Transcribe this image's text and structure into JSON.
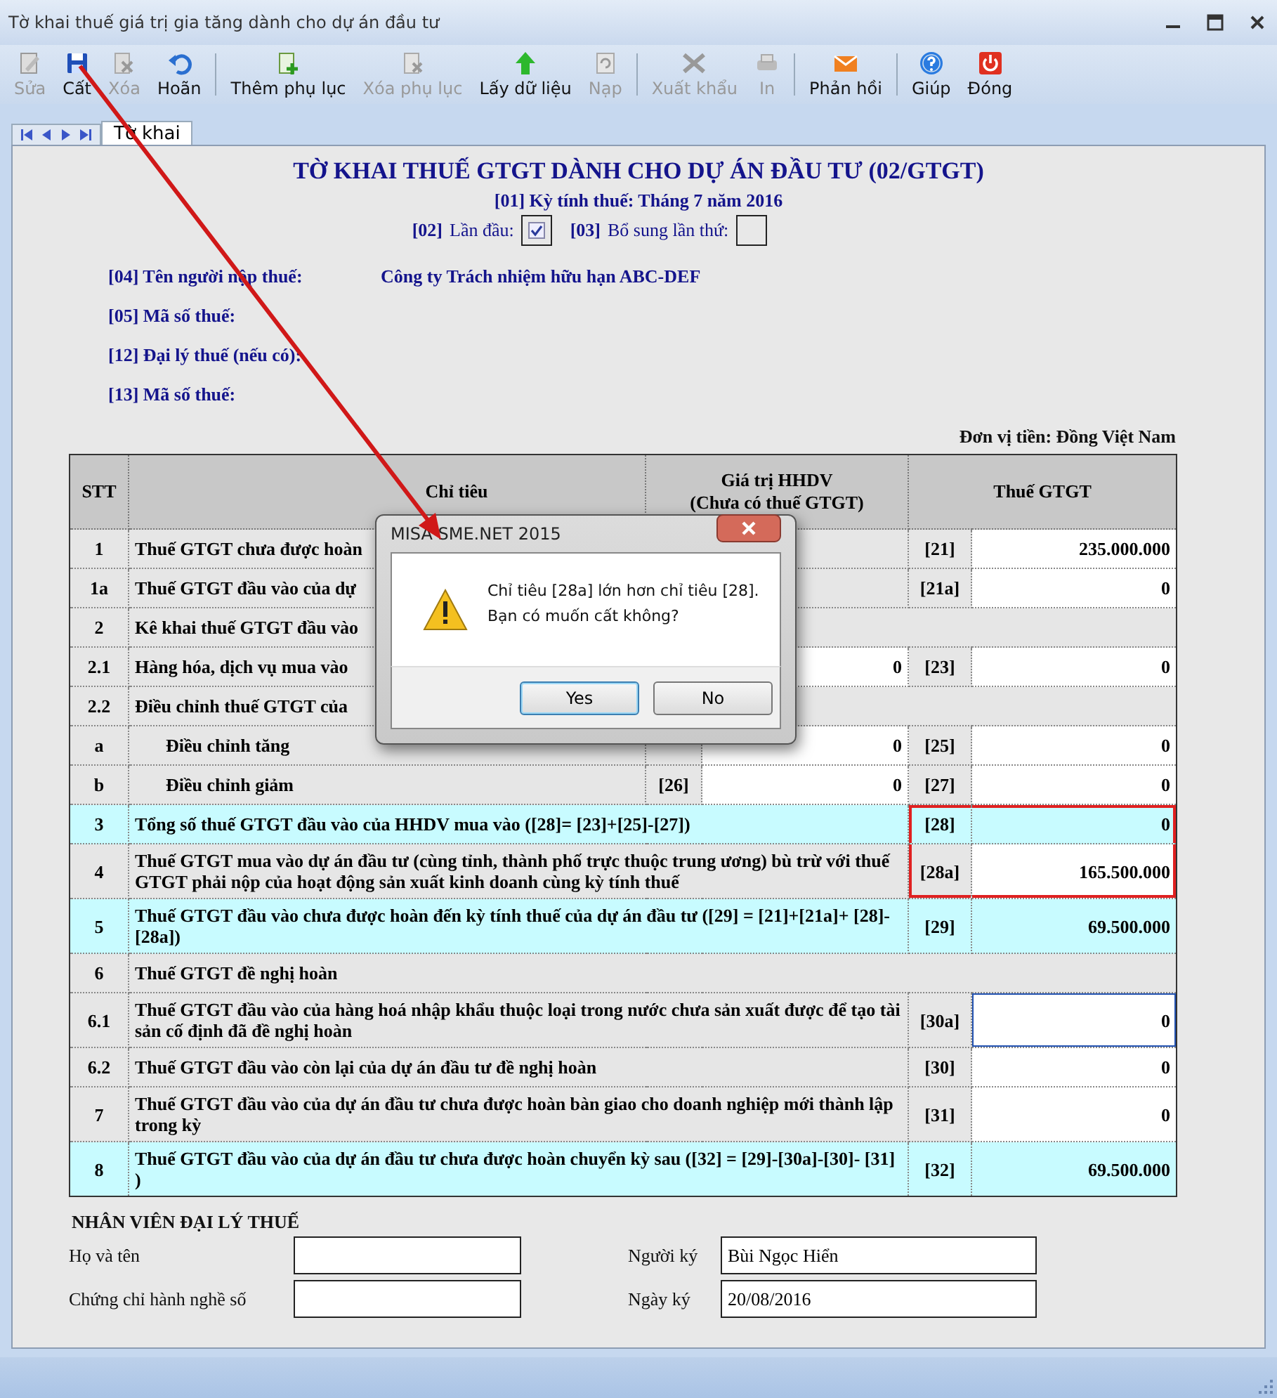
{
  "window": {
    "title": "Tờ khai thuế giá trị gia tăng dành cho dự án đầu tư"
  },
  "toolbar": [
    {
      "label": "Sửa",
      "disabled": true,
      "separator_after": false
    },
    {
      "label": "Cất",
      "disabled": false,
      "separator_after": false
    },
    {
      "label": "Xóa",
      "disabled": true,
      "separator_after": false
    },
    {
      "label": "Hoãn",
      "disabled": false,
      "separator_after": true
    },
    {
      "label": "Thêm phụ lục",
      "disabled": false,
      "separator_after": false
    },
    {
      "label": "Xóa phụ lục",
      "disabled": true,
      "separator_after": false
    },
    {
      "label": "Lấy dữ liệu",
      "disabled": false,
      "separator_after": false
    },
    {
      "label": "Nạp",
      "disabled": true,
      "separator_after": true
    },
    {
      "label": "Xuất khẩu",
      "disabled": true,
      "separator_after": false
    },
    {
      "label": "In",
      "disabled": true,
      "separator_after": true
    },
    {
      "label": "Phản hồi",
      "disabled": false,
      "separator_after": true
    },
    {
      "label": "Giúp",
      "disabled": false,
      "separator_after": false
    },
    {
      "label": "Đóng",
      "disabled": false,
      "separator_after": false
    }
  ],
  "tabs": [
    {
      "label": "Tờ khai",
      "selected": true
    }
  ],
  "form": {
    "title": "TỜ KHAI THUẾ GTGT DÀNH CHO DỰ ÁN ĐẦU TƯ (02/GTGT)",
    "period": "[01] Kỳ tính thuế: Tháng 7 năm 2016",
    "first_code": "[02]",
    "first_label": "Lần đầu:",
    "first_checked": true,
    "supplement_code": "[03]",
    "supplement_label": "Bổ sung lần thứ:",
    "info": [
      {
        "label": "[04] Tên người nộp thuế:",
        "value": "Công ty Trách nhiệm hữu hạn ABC-DEF"
      },
      {
        "label": "[05] Mã số thuế:"
      },
      {
        "label": "[12] Đại lý thuế (nếu có):"
      },
      {
        "label": "[13] Mã số thuế:"
      }
    ],
    "currency": "Đơn vị tiền: Đồng Việt Nam"
  },
  "table": {
    "columns": [
      "STT",
      "Chỉ tiêu",
      "Giá trị HHDV\n(Chưa có thuế GTGT)",
      "Thuế GTGT"
    ],
    "rows": [
      {
        "kind": "tax",
        "stt": "1",
        "label": "Thuế GTGT chưa được hoàn",
        "code": "[21]",
        "value": "235.000.000",
        "highlighted": false,
        "outlined": false,
        "focused": false
      },
      {
        "kind": "tax",
        "stt": "1a",
        "label": "Thuế GTGT đầu vào của dự",
        "code": "[21a]",
        "value": "0",
        "highlighted": false,
        "outlined": false,
        "focused": false
      },
      {
        "kind": "section",
        "stt": "2",
        "label": "Kê khai thuế GTGT đầu vào"
      },
      {
        "kind": "both",
        "stt": "2.1",
        "label": "Hàng hóa, dịch vụ mua vào",
        "gt_value": "0",
        "code": "[23]",
        "value": "0",
        "highlighted": false,
        "outlined": false,
        "focused": false
      },
      {
        "kind": "section",
        "stt": "2.2",
        "label": "Điều chỉnh thuế GTGT của",
        "children": [
          {
            "kind": "both",
            "stt": "a",
            "label": "Điều chỉnh tăng",
            "gt_value": "0",
            "code": "[25]",
            "value": "0",
            "highlighted": false,
            "outlined": false,
            "focused": false
          },
          {
            "kind": "both",
            "stt": "b",
            "label": "Điều chỉnh giảm",
            "gt_code": "[26]",
            "gt_value": "0",
            "code": "[27]",
            "value": "0",
            "highlighted": false,
            "outlined": false,
            "focused": false
          }
        ]
      },
      {
        "kind": "tax",
        "stt": "3",
        "label": "Tổng số thuế GTGT đầu vào của HHDV mua vào ([28]= [23]+[25]-[27])",
        "code": "[28]",
        "value": "0",
        "highlighted": true,
        "outlined": true,
        "focused": false
      },
      {
        "kind": "tax",
        "stt": "4",
        "label": "Thuế GTGT mua vào dự án đầu tư (cùng tỉnh, thành phố trực thuộc trung ương) bù trừ với thuế GTGT phải nộp của hoạt động sản xuất kinh doanh cùng kỳ tính thuế",
        "code": "[28a]",
        "value": "165.500.000",
        "highlighted": false,
        "outlined": true,
        "focused": false
      },
      {
        "kind": "tax",
        "stt": "5",
        "label": "Thuế GTGT đầu vào chưa được hoàn đến kỳ tính thuế của dự án đầu tư ([29] = [21]+[21a]+ [28]-[28a])",
        "code": "[29]",
        "value": "69.500.000",
        "highlighted": true,
        "outlined": false,
        "focused": false
      },
      {
        "kind": "section",
        "stt": "6",
        "label": "Thuế GTGT đề nghị hoàn"
      },
      {
        "kind": "tax",
        "stt": "6.1",
        "label": "Thuế GTGT đầu vào của hàng hoá nhập khẩu thuộc loại trong nước chưa sản xuất được để tạo tài sản cố định đã đề nghị hoàn",
        "code": "[30a]",
        "value": "0",
        "highlighted": false,
        "outlined": false,
        "focused": true
      },
      {
        "kind": "tax",
        "stt": "6.2",
        "label": "Thuế GTGT đầu vào còn lại của dự án đầu tư đề nghị hoàn",
        "code": "[30]",
        "value": "0",
        "highlighted": false,
        "outlined": false,
        "focused": false
      },
      {
        "kind": "tax",
        "stt": "7",
        "label": "Thuế GTGT đầu vào của dự án đầu tư chưa được hoàn bàn giao cho doanh nghiệp mới thành lập trong kỳ",
        "code": "[31]",
        "value": "0",
        "highlighted": false,
        "outlined": false,
        "focused": false
      },
      {
        "kind": "tax",
        "stt": "8",
        "label": "Thuế GTGT đầu vào của dự án đầu tư chưa được hoàn chuyển kỳ sau ([32] = [29]-[30a]-[30]- [31] )",
        "code": "[32]",
        "value": "69.500.000",
        "highlighted": true,
        "outlined": false,
        "focused": false
      }
    ]
  },
  "agent": {
    "heading": "NHÂN VIÊN ĐẠI LÝ THUẾ",
    "fields": [
      {
        "label": "Họ và tên"
      },
      {
        "label": "Người ký",
        "value": "Bùi Ngọc Hiển"
      },
      {
        "label": "Chứng chỉ hành nghề số"
      },
      {
        "label": "Ngày ký",
        "value": "20/08/2016"
      }
    ]
  },
  "dialog": {
    "title": "MISA SME.NET 2015",
    "message": [
      "Chỉ tiêu [28a] lớn hơn chỉ tiêu [28].",
      "Bạn có muốn cất không?"
    ],
    "buttons": [
      {
        "label": "Yes",
        "selected": true
      },
      {
        "label": "No",
        "selected": false
      }
    ]
  }
}
